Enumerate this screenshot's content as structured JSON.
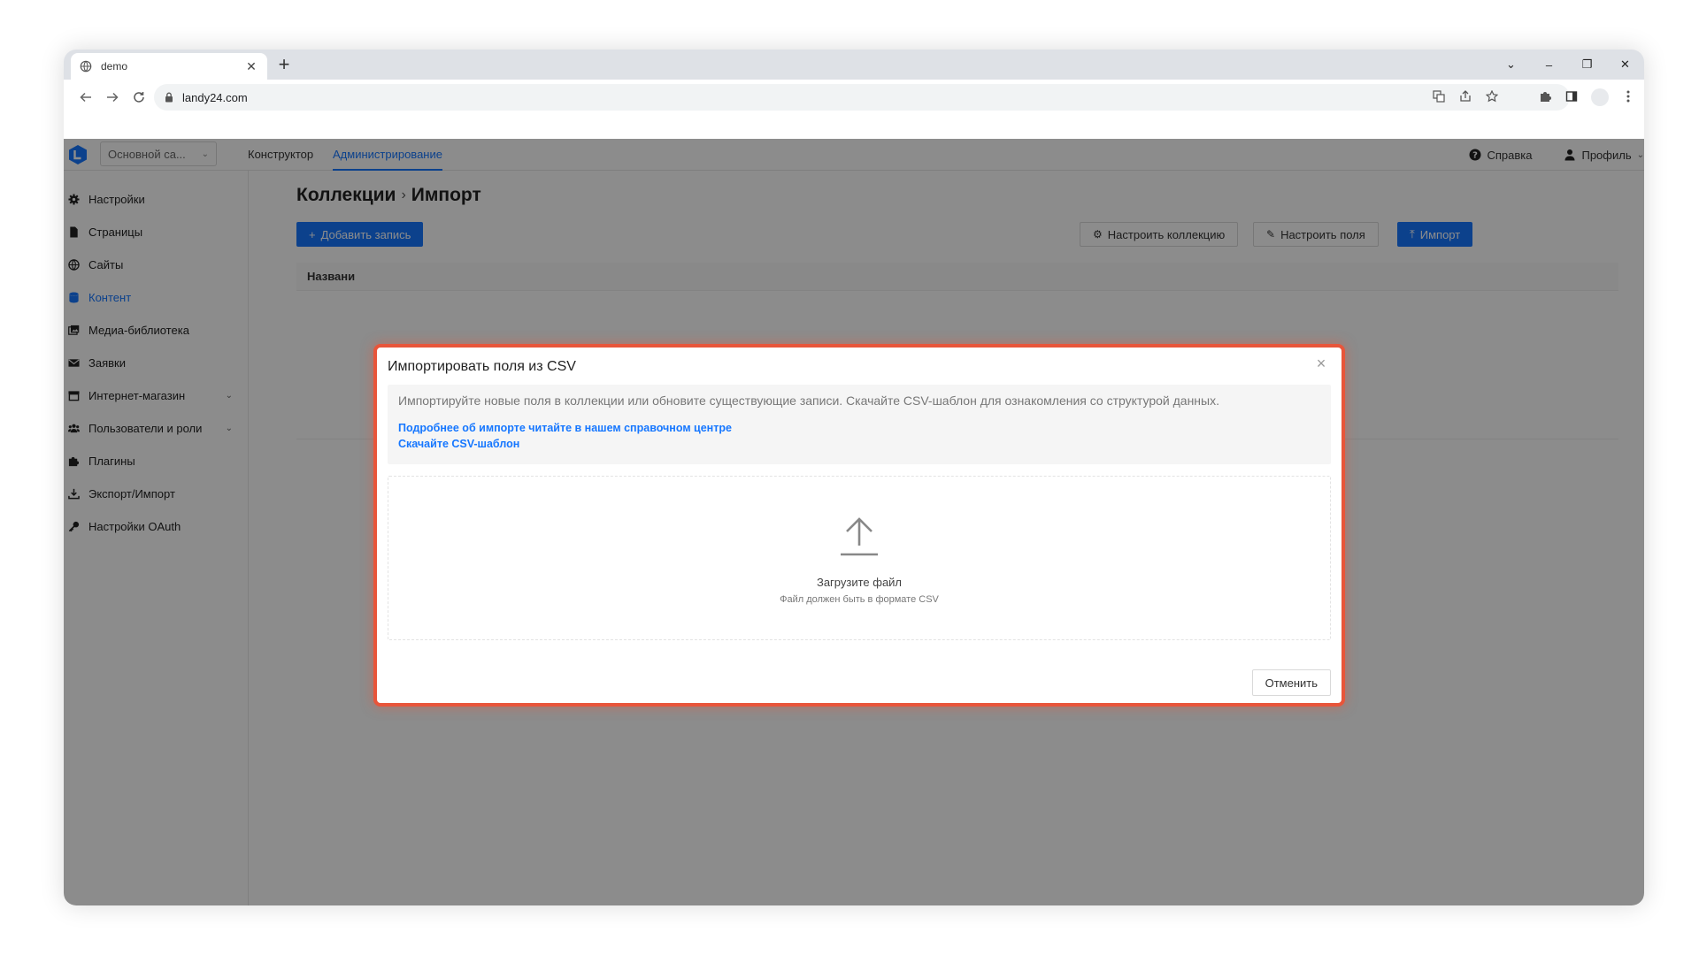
{
  "browser": {
    "tab_title": "demo",
    "url": "landy24.com",
    "new_tab_glyph": "+",
    "tab_close_glyph": "✕",
    "window_controls": [
      "⌄",
      "–",
      "❐",
      "✕"
    ]
  },
  "topnav": {
    "site_select_value": "Основной са...",
    "links": [
      "Конструктор",
      "Администрирование"
    ],
    "active_link": "Администрирование",
    "help_label": "Справка",
    "profile_label": "Профиль"
  },
  "sidebar": {
    "items": [
      {
        "label": "Настройки",
        "icon": "gear-icon"
      },
      {
        "label": "Страницы",
        "icon": "file-icon"
      },
      {
        "label": "Сайты",
        "icon": "globe-icon"
      },
      {
        "label": "Контент",
        "icon": "database-icon",
        "active": true
      },
      {
        "label": "Медиа-библиотека",
        "icon": "images-icon"
      },
      {
        "label": "Заявки",
        "icon": "envelope-icon"
      },
      {
        "label": "Интернет-магазин",
        "icon": "store-icon",
        "has_submenu": true
      },
      {
        "label": "Пользователи и роли",
        "icon": "users-icon",
        "has_submenu": true
      },
      {
        "label": "Плагины",
        "icon": "puzzle-icon"
      },
      {
        "label": "Экспорт/Импорт",
        "icon": "download-icon"
      },
      {
        "label": "Настройки OAuth",
        "icon": "key-icon"
      }
    ]
  },
  "main": {
    "breadcrumb": [
      "Коллекции",
      "Импорт"
    ],
    "add_record_label": "Добавить запись",
    "configure_collection_label": "Настроить коллекцию",
    "configure_fields_label": "Настроить поля",
    "import_label": "Импорт",
    "table_column": "Названи"
  },
  "modal": {
    "title": "Импортировать поля из CSV",
    "description": "Импортируйте новые поля в коллекции или обновите существующие записи. Скачайте CSV-шаблон для ознакомления со структурой данных.",
    "help_link": "Подробнее об импорте читайте в нашем справочном центре",
    "template_link": "Скачайте CSV-шаблон",
    "upload_title": "Загрузите файл",
    "upload_hint": "Файл должен быть в формате CSV",
    "cancel_label": "Отменить"
  },
  "colors": {
    "accent": "#1677ff",
    "highlight_border": "#e8553a"
  }
}
